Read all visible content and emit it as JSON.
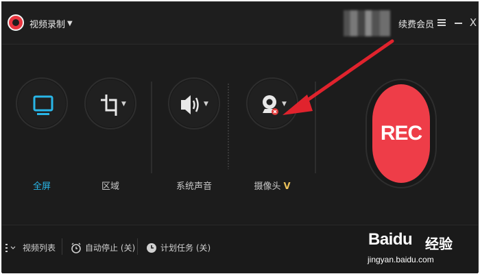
{
  "titlebar": {
    "mode_label": "视频录制",
    "vip_label": "续费会员",
    "close_glyph": "X"
  },
  "capture": {
    "fullscreen_label": "全屏",
    "region_label": "区域",
    "audio_label": "系统声音",
    "camera_label": "摄像头",
    "camera_vip_badge": "V",
    "rec_label": "REC"
  },
  "bottombar": {
    "video_list_label": "视频列表",
    "auto_stop_label": "自动停止 (关)",
    "schedule_label": "计划任务 (关)"
  },
  "watermark": {
    "brand": "Baidu",
    "suffix": "经验",
    "url": "jingyan.baidu.com"
  },
  "colors": {
    "accent_blue": "#29b6e8",
    "rec_red": "#ee3d48",
    "annotation_red": "#e0232d",
    "vip_gold": "#e9c05a"
  }
}
